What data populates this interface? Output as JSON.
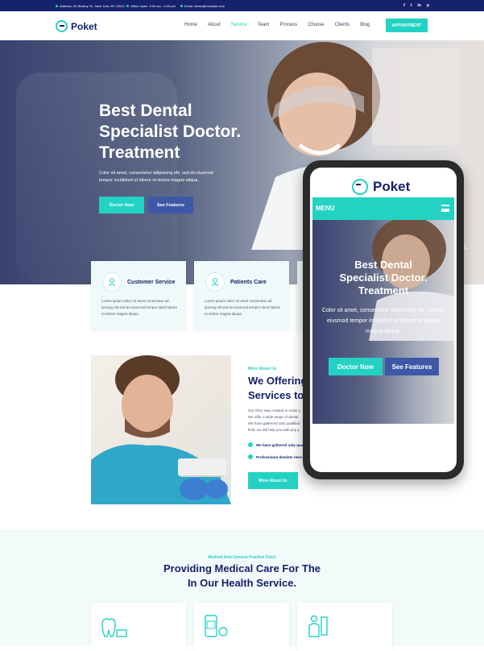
{
  "topbar": {
    "address": "Address: 92 Bowery St., New York, NY 10013",
    "hours": "Office Open: 9:00 am - 6:00 pm",
    "email": "Email: demo@example.com",
    "social": [
      "f",
      "t",
      "in",
      "p"
    ]
  },
  "header": {
    "logo": "Poket",
    "nav": [
      "Home",
      "About",
      "Service",
      "Team",
      "Process",
      "Choose",
      "Clients",
      "Blog"
    ],
    "active_nav": "Service",
    "appointment": "APPOINTMENT"
  },
  "hero": {
    "title_lines": [
      "Best Dental",
      "Specialist Doctor.",
      "Treatment"
    ],
    "subtitle_lines": [
      "Color sit amet, consectetur adipiscing elit, sed do eiusmod",
      "tempor incididunt ut labore et dolore magna aliqua."
    ],
    "btn_primary": "Doctor Now",
    "btn_secondary": "See Features"
  },
  "services": [
    {
      "title": "Customer Service",
      "text": "Lorem ipsum dolor sit amet consectetu ad ipscing elit sed do eiusmod tempor idunt labore et dolore magna aliqua."
    },
    {
      "title": "Patients Care",
      "text": "Lorem ipsum dolor sit amet consectetu ad ipscing elit sed do eiusmod tempor idunt labore et dolore magna aliqua."
    }
  ],
  "about": {
    "tag": "More About Us",
    "title_lines": [
      "We Offering",
      "Services to"
    ],
    "text_lines": [
      "Our clinic was created to make y",
      "We offer a wide range of dental",
      "We have gathered only qualified",
      "field, we will help you with any p"
    ],
    "checks": [
      "We have gathered only qua",
      "Professional dentists rienc"
    ],
    "button": "More About Us"
  },
  "bottom": {
    "tag": "Medical And General Practice Care!",
    "title_lines": [
      "Providing Medical Care For The",
      "In Our Health Service."
    ]
  },
  "phone": {
    "logo": "Poket",
    "menu": "MENU",
    "title_lines": [
      "Best Dental",
      "Specialist Doctor.",
      "Treatment"
    ],
    "subtitle_lines": [
      "Color sit amet, consectetur adipiscing elit, sed do",
      "eiusmod tempor incididunt ut labore et dolore",
      "magna aliqua."
    ],
    "btn_primary": "Doctor Now",
    "btn_secondary": "See Features"
  },
  "colors": {
    "accent": "#23d2c3",
    "navy": "#15226b",
    "blue_button": "#3e58a8"
  }
}
